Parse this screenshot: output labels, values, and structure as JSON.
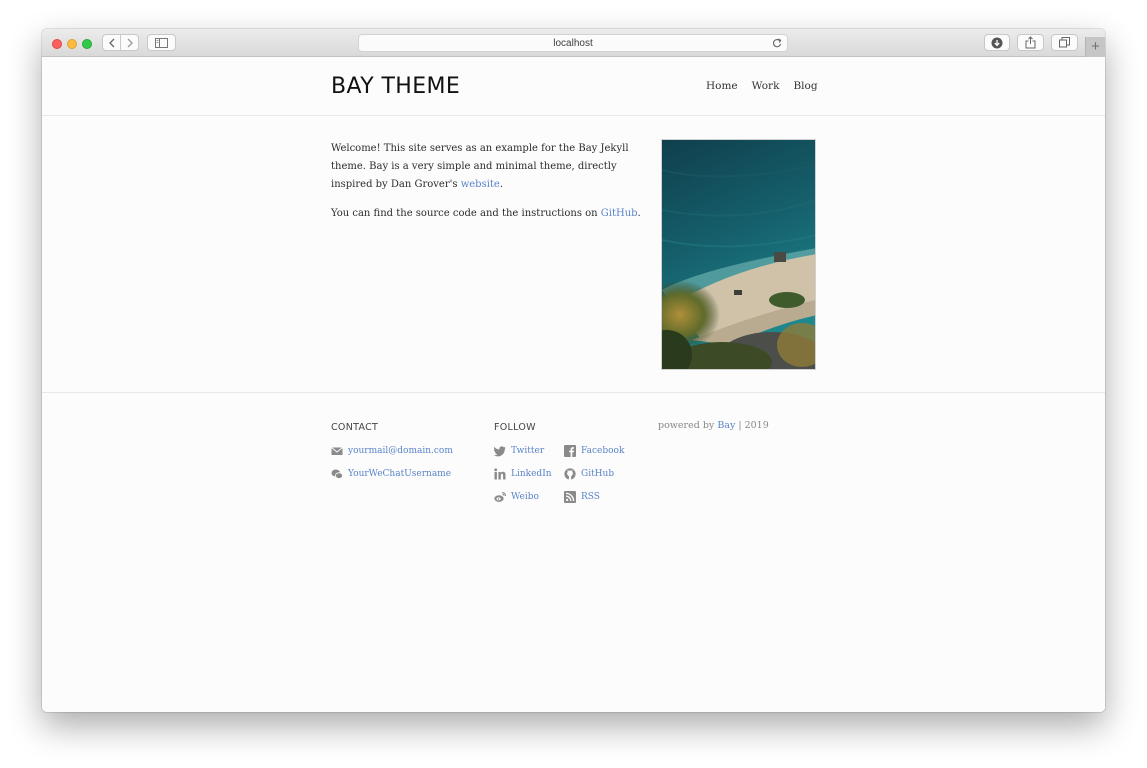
{
  "browser": {
    "url": "localhost"
  },
  "header": {
    "site_title": "BAY THEME",
    "nav": [
      {
        "label": "Home"
      },
      {
        "label": "Work"
      },
      {
        "label": "Blog"
      }
    ]
  },
  "intro": {
    "p1_text": "Welcome! This site serves as an example for the Bay Jekyll theme. Bay is a very simple and minimal theme, directly inspired by Dan Grover's ",
    "p1_link": "website",
    "p1_end": ".",
    "p2_text": "You can find the source code and the instructions on ",
    "p2_link": "GitHub",
    "p2_end": "."
  },
  "footer": {
    "contact_heading": "CONTACT",
    "contact": [
      {
        "label": "yourmail@domain.com",
        "icon": "mail-icon"
      },
      {
        "label": "YourWeChatUsername",
        "icon": "wechat-icon"
      }
    ],
    "follow_heading": "FOLLOW",
    "follow": [
      {
        "label": "Twitter",
        "icon": "twitter-icon"
      },
      {
        "label": "Facebook",
        "icon": "facebook-icon"
      },
      {
        "label": "LinkedIn",
        "icon": "linkedin-icon"
      },
      {
        "label": "GitHub",
        "icon": "github-icon"
      },
      {
        "label": "Weibo",
        "icon": "weibo-icon"
      },
      {
        "label": "RSS",
        "icon": "rss-icon"
      }
    ],
    "powered_prefix": "powered by",
    "powered_link": "Bay",
    "powered_year": "| 2019"
  },
  "colors": {
    "link": "#5a84c8",
    "text": "#2b2b2b",
    "icon_gray": "#8a8a8a"
  }
}
